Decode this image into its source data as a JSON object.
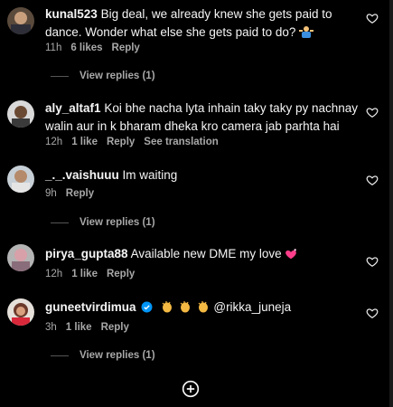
{
  "comments": [
    {
      "username": "kunal523",
      "text": "Big deal, we already knew she gets paid to dance. Wonder what else she gets paid to do?",
      "time": "11h",
      "likes": "6 likes",
      "reply": "Reply",
      "view_replies": "View replies (1)",
      "avatar_icon": "avatar-photo"
    },
    {
      "username": "aly_altaf1",
      "text": "Koi bhe nacha lyta inhain taky taky py nachnay walin aur in k bharam dheka kro camera jab parhta hai",
      "time": "12h",
      "likes": "1 like",
      "reply": "Reply",
      "see_translation": "See translation",
      "avatar_icon": "avatar-photo"
    },
    {
      "username": "_._.vaishuuu",
      "text": "Im waiting",
      "time": "9h",
      "reply": "Reply",
      "view_replies": "View replies (1)",
      "avatar_icon": "avatar-photo"
    },
    {
      "username": "pirya_gupta88",
      "text": "Available new DME my love",
      "time": "12h",
      "likes": "1 like",
      "reply": "Reply",
      "avatar_icon": "avatar-photo"
    },
    {
      "username": "guneetvirdimua",
      "text": "@rikka_juneja",
      "time": "3h",
      "likes": "1 like",
      "reply": "Reply",
      "view_replies": "View replies (1)",
      "verified": true,
      "avatar_icon": "avatar-photo"
    }
  ],
  "icons": {
    "heart": "heart-outline-icon",
    "add": "plus-circle-icon",
    "verified": "verified-badge-icon"
  },
  "colors": {
    "background": "#000000",
    "text": "#f5f5f5",
    "secondary": "#a8a8a8",
    "verified": "#0095f6"
  }
}
